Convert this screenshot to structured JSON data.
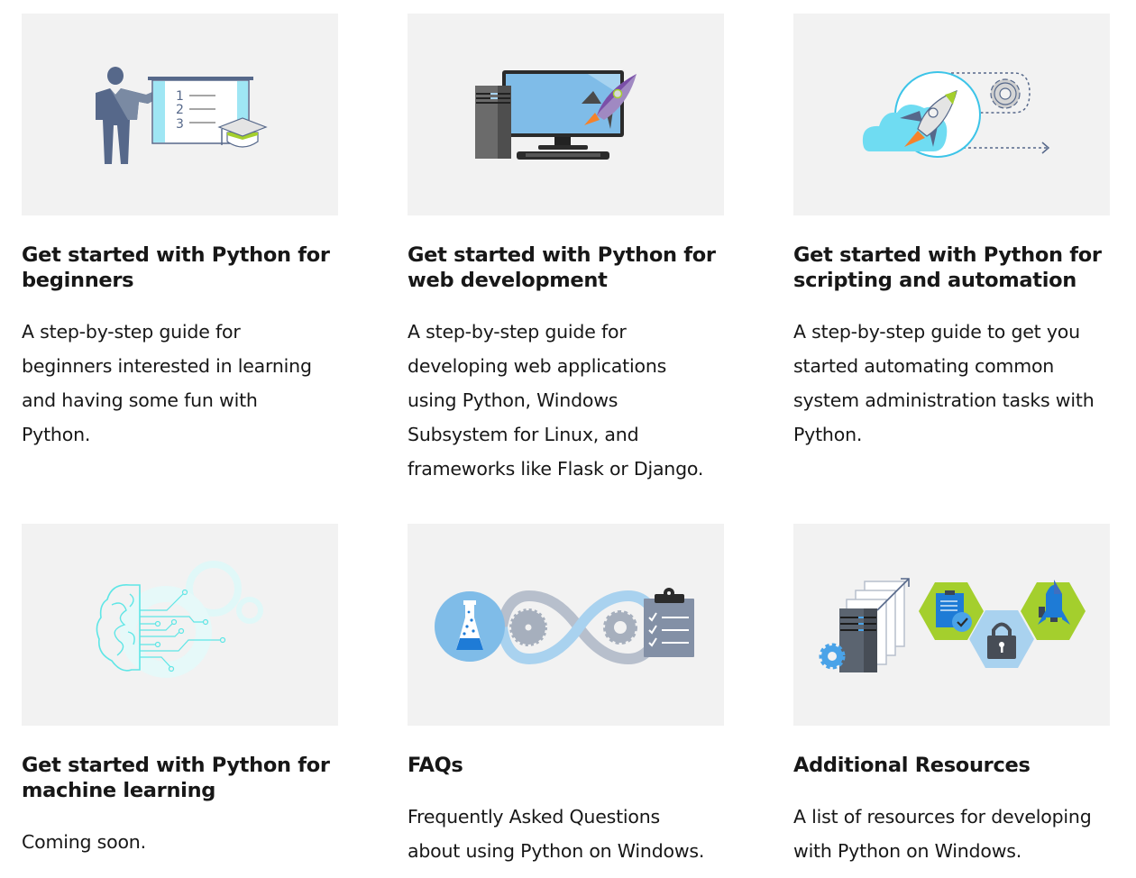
{
  "cards": [
    {
      "title": "Get started with Python for beginners",
      "title_lines": [
        "Get started with Python for",
        "beginners"
      ],
      "description_lines": [
        "A step-by-step guide for",
        "beginners interested in learning",
        "and having some fun with",
        "Python."
      ],
      "image": "teacher-presentation-illustration"
    },
    {
      "title": "Get started with Python for web development",
      "title_lines": [
        "Get started with Python for",
        "web development"
      ],
      "description_lines": [
        "A step-by-step guide for",
        "developing web applications",
        "using Python, Windows",
        "Subsystem for Linux, and",
        "frameworks like Flask or Django."
      ],
      "image": "desktop-computer-rocket-illustration"
    },
    {
      "title": "Get started with Python for scripting and automation",
      "title_lines": [
        "Get started with Python for",
        "scripting and automation"
      ],
      "description_lines": [
        "A step-by-step guide to get you",
        "started automating common",
        "system administration tasks with",
        "Python."
      ],
      "image": "cloud-rocket-gear-illustration"
    },
    {
      "title": "Get started with Python for machine learning",
      "title_lines": [
        "Get started with Python for",
        "machine learning"
      ],
      "description_lines": [
        "Coming soon."
      ],
      "image": "brain-circuit-gears-illustration"
    },
    {
      "title": "FAQs",
      "title_lines": [
        "FAQs"
      ],
      "description_lines": [
        "Frequently Asked Questions",
        "about using Python on Windows."
      ],
      "image": "flask-infinity-checklist-illustration"
    },
    {
      "title": "Additional Resources",
      "title_lines": [
        "Additional Resources"
      ],
      "description_lines": [
        "A list of resources for developing",
        "with Python on Windows."
      ],
      "image": "server-hexagons-illustration"
    }
  ],
  "colors": {
    "tile_background": "#f2f2f2",
    "text": "#171717",
    "slate": "#56688a",
    "light_blue": "#7fbce8",
    "cyan": "#5ee6e6",
    "lime": "#a4cf2d",
    "purple": "#7b4fa8",
    "orange": "#f5822a"
  }
}
